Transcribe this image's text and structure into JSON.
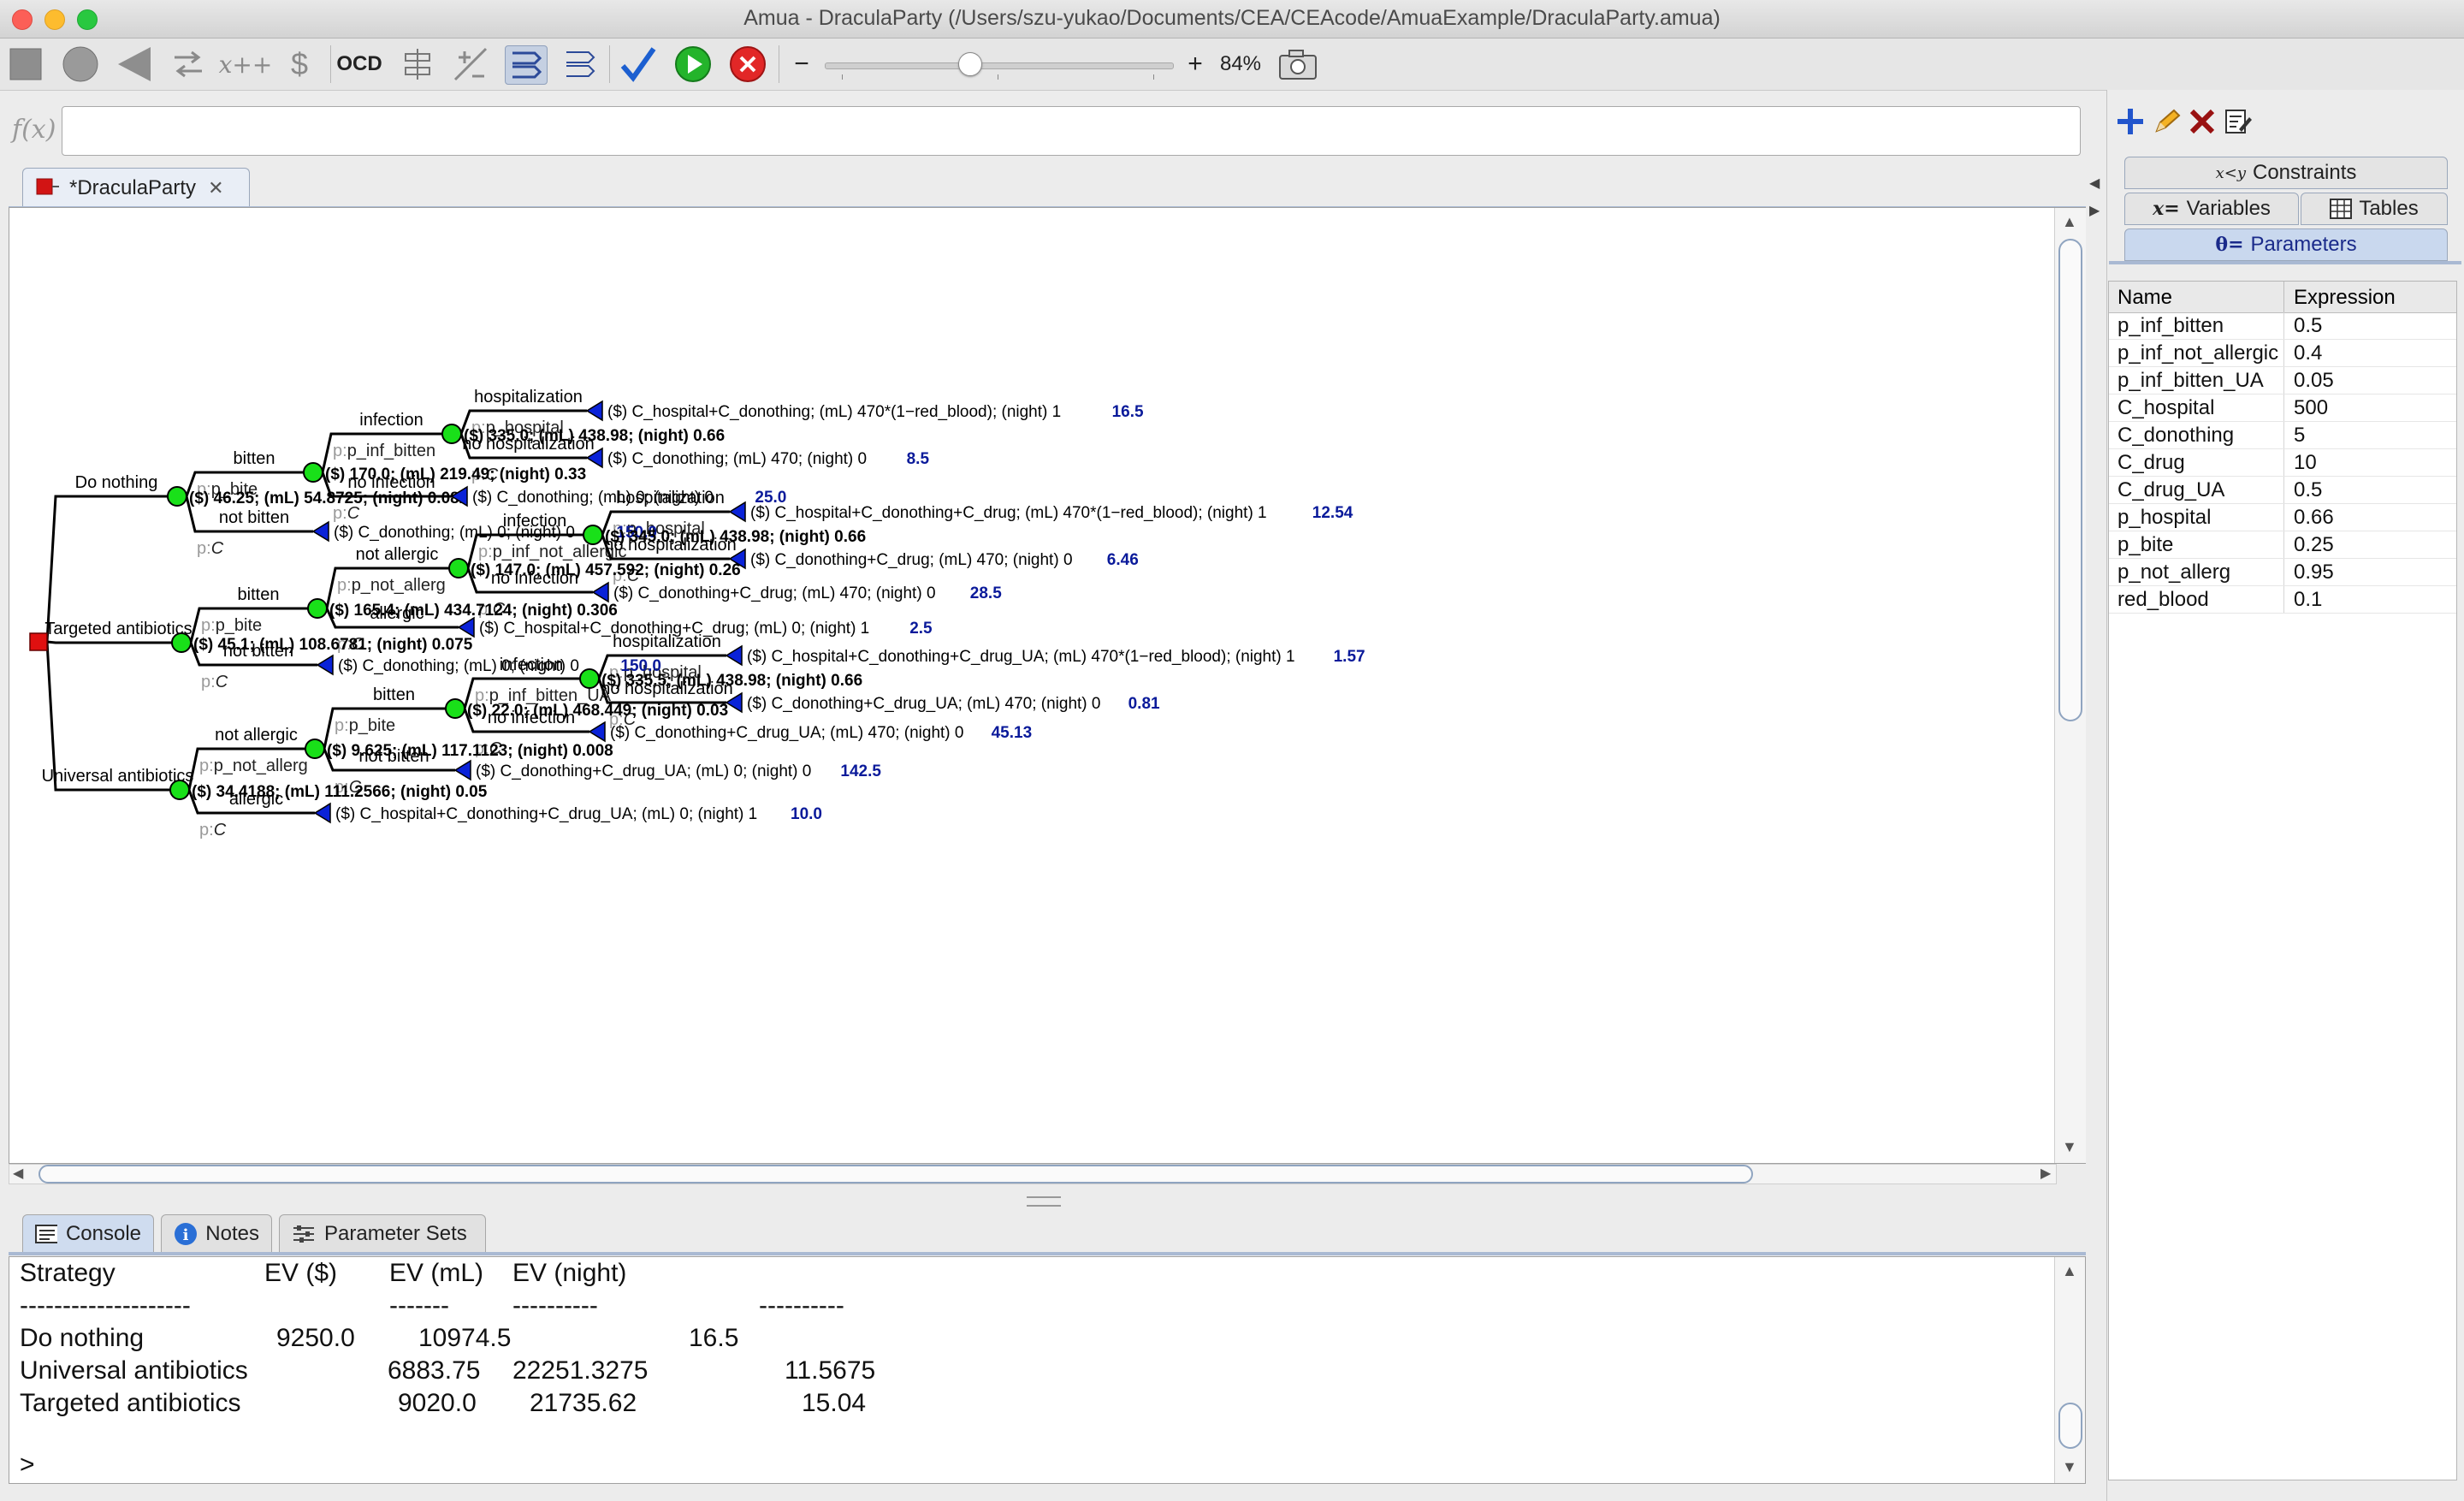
{
  "window": {
    "title": "Amua - DraculaParty (/Users/szu-yukao/Documents/CEA/CEAcode/AmuaExample/DraculaParty.amua)"
  },
  "toolbar": {
    "ocd_label": "OCD",
    "zoom_minus": "−",
    "zoom_plus": "+",
    "zoom_level": "84%",
    "zoom_fraction": 0.41
  },
  "formula": {
    "label": "f(x)",
    "value": ""
  },
  "doc_tab": {
    "label": "*DraculaParty"
  },
  "tree": {
    "root_strategies": [
      "Do nothing",
      "Targeted antibiotics",
      "Universal antibiotics"
    ],
    "nodes": [
      {
        "id": "dn",
        "label": "Do nothing",
        "prob": "",
        "ev": "($) 46.25; (mL) 54.8725; (night) 0.082"
      },
      {
        "id": "dn_b",
        "label": "bitten",
        "prob": "p_bite",
        "ev": "($) 170.0; (mL) 219.49; (night) 0.33"
      },
      {
        "id": "dn_nb",
        "label": "not bitten",
        "prob": "C",
        "payoff": "($) C_donothing; (mL) 0; (night) 0",
        "value": "150.0"
      },
      {
        "id": "dn_b_i",
        "label": "infection",
        "prob": "p_inf_bitten",
        "ev": "($) 335.0; (mL) 438.98; (night) 0.66"
      },
      {
        "id": "dn_b_ni",
        "label": "no infection",
        "prob": "C",
        "payoff": "($) C_donothing; (mL) 0; (night) 0",
        "value": "25.0"
      },
      {
        "id": "dn_b_i_h",
        "label": "hospitalization",
        "prob": "p_hospital",
        "payoff": "($) C_hospital+C_donothing; (mL) 470*(1−red_blood); (night) 1",
        "value": "16.5"
      },
      {
        "id": "dn_b_i_nh",
        "label": "no hospitalization",
        "prob": "C",
        "payoff": "($) C_donothing; (mL) 470; (night) 0",
        "value": "8.5"
      },
      {
        "id": "ta",
        "label": "Targeted antibiotics",
        "prob": "",
        "ev": "($) 45.1; (mL) 108.6781; (night) 0.075"
      },
      {
        "id": "ta_b",
        "label": "bitten",
        "prob": "p_bite",
        "ev": "($) 165.4; (mL) 434.7124; (night) 0.306"
      },
      {
        "id": "ta_nb",
        "label": "not bitten",
        "prob": "C",
        "payoff": "($) C_donothing; (mL) 0; (night) 0",
        "value": "150.0"
      },
      {
        "id": "ta_b_na",
        "label": "not allergic",
        "prob": "p_not_allerg",
        "ev": "($) 147.0; (mL) 457.592; (night) 0.26"
      },
      {
        "id": "ta_b_a",
        "label": "allergic",
        "prob": "C",
        "payoff": "($) C_hospital+C_donothing+C_drug; (mL) 0; (night) 1",
        "value": "2.5"
      },
      {
        "id": "ta_b_na_i",
        "label": "infection",
        "prob": "p_inf_not_allergic",
        "ev": "($) 345.0; (mL) 438.98; (night) 0.66"
      },
      {
        "id": "ta_b_na_ni",
        "label": "no infection",
        "prob": "C",
        "payoff": "($) C_donothing+C_drug; (mL) 470; (night) 0",
        "value": "28.5"
      },
      {
        "id": "ta_b_na_i_h",
        "label": "hospitalization",
        "prob": "p_hospital",
        "payoff": "($) C_hospital+C_donothing+C_drug; (mL) 470*(1−red_blood); (night) 1",
        "value": "12.54"
      },
      {
        "id": "ta_b_na_i_nh",
        "label": "no hospitalization",
        "prob": "C",
        "payoff": "($) C_donothing+C_drug; (mL) 470; (night) 0",
        "value": "6.46"
      },
      {
        "id": "ua",
        "label": "Universal antibiotics",
        "prob": "",
        "ev": "($) 34.4188; (mL) 111.2566; (night) 0.05"
      },
      {
        "id": "ua_na",
        "label": "not allergic",
        "prob": "p_not_allerg",
        "ev": "($) 9.625; (mL) 117.1123; (night) 0.008"
      },
      {
        "id": "ua_a",
        "label": "allergic",
        "prob": "C",
        "payoff": "($) C_hospital+C_donothing+C_drug_UA; (mL) 0; (night) 1",
        "value": "10.0"
      },
      {
        "id": "ua_na_b",
        "label": "bitten",
        "prob": "p_bite",
        "ev": "($) 22.0; (mL) 468.449; (night) 0.03"
      },
      {
        "id": "ua_na_nb",
        "label": "not bitten",
        "prob": "C",
        "payoff": "($) C_donothing+C_drug_UA; (mL) 0; (night) 0",
        "value": "142.5"
      },
      {
        "id": "ua_na_b_i",
        "label": "infection",
        "prob": "p_inf_bitten_UA",
        "ev": "($) 335.5; (mL) 438.98; (night) 0.66"
      },
      {
        "id": "ua_na_b_ni",
        "label": "no infection",
        "prob": "C",
        "payoff": "($) C_donothing+C_drug_UA; (mL) 470; (night) 0",
        "value": "45.13"
      },
      {
        "id": "ua_na_b_i_h",
        "label": "hospitalization",
        "prob": "p_hospital",
        "payoff": "($) C_hospital+C_donothing+C_drug_UA; (mL) 470*(1−red_blood); (night) 1",
        "value": "1.57"
      },
      {
        "id": "ua_na_b_i_nh",
        "label": "no hospitalization",
        "prob": "C",
        "payoff": "($) C_donothing+C_drug_UA; (mL) 470; (night) 0",
        "value": "0.81"
      }
    ]
  },
  "bottom_tabs": {
    "console": "Console",
    "notes": "Notes",
    "param_sets": "Parameter Sets"
  },
  "console": {
    "headers": [
      "Strategy",
      "EV ($)",
      "EV (mL)",
      "EV (night)"
    ],
    "dashes": [
      "--------------------",
      "-------",
      "----------",
      "----------"
    ],
    "rows": [
      {
        "strategy": "Do nothing",
        "ev_cost": "9250.0",
        "ev_ml": "10974.5",
        "ev_night": "16.5"
      },
      {
        "strategy": "Universal antibiotics",
        "ev_cost": "6883.75",
        "ev_ml": "22251.3275",
        "ev_night": "11.5675"
      },
      {
        "strategy": "Targeted antibiotics",
        "ev_cost": "9020.0",
        "ev_ml": "21735.62",
        "ev_night": "15.04"
      }
    ],
    "prompt": ">"
  },
  "right_panel": {
    "tabs": {
      "constraints": "Constraints",
      "variables": "Variables",
      "tables": "Tables",
      "parameters": "Parameters"
    },
    "columns": [
      "Name",
      "Expression"
    ],
    "rows": [
      {
        "name": "p_inf_bitten",
        "expr": "0.5"
      },
      {
        "name": "p_inf_not_allergic",
        "expr": "0.4"
      },
      {
        "name": "p_inf_bitten_UA",
        "expr": "0.05"
      },
      {
        "name": "C_hospital",
        "expr": "500"
      },
      {
        "name": "C_donothing",
        "expr": "5"
      },
      {
        "name": "C_drug",
        "expr": "10"
      },
      {
        "name": "C_drug_UA",
        "expr": "0.5"
      },
      {
        "name": "p_hospital",
        "expr": "0.66"
      },
      {
        "name": "p_bite",
        "expr": "0.25"
      },
      {
        "name": "p_not_allerg",
        "expr": "0.95"
      },
      {
        "name": "red_blood",
        "expr": "0.1"
      }
    ]
  },
  "colors": {
    "chance_node": "#19e019",
    "terminal": "#0a22d8",
    "decision": "#e01010",
    "value_text": "#0a1a9a"
  }
}
